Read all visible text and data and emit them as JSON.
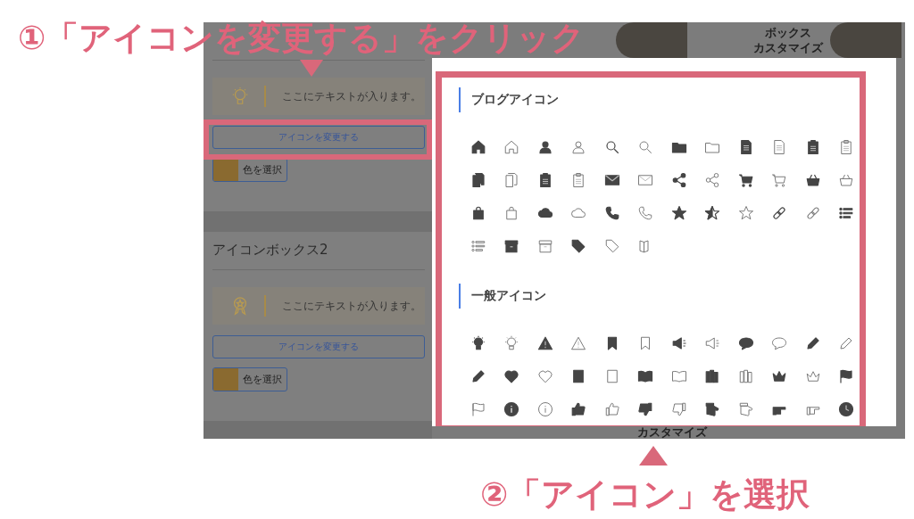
{
  "annotations": {
    "step1": "①「アイコンを変更する」をクリック",
    "step2": "②「アイコン」を選択"
  },
  "background": {
    "thumbnails": [
      {
        "lines": [
          "ボックス",
          "カスタマイズ"
        ]
      }
    ],
    "bottom_caption": "カスタマイズ"
  },
  "settings_panel": {
    "blocks": [
      {
        "preview_text": "ここにテキストが入ります。",
        "change_button": "アイコンを変更する",
        "color_button": "色を選択",
        "highlighted": true
      },
      {
        "title": "アイコンボックス2",
        "preview_text": "ここにテキストが入ります。",
        "change_button": "アイコンを変更する",
        "color_button": "色を選択",
        "highlighted": false
      }
    ]
  },
  "icon_picker": {
    "highlighted": true,
    "sections": [
      {
        "title": "ブログアイコン"
      },
      {
        "title": "一般アイコン"
      }
    ]
  }
}
